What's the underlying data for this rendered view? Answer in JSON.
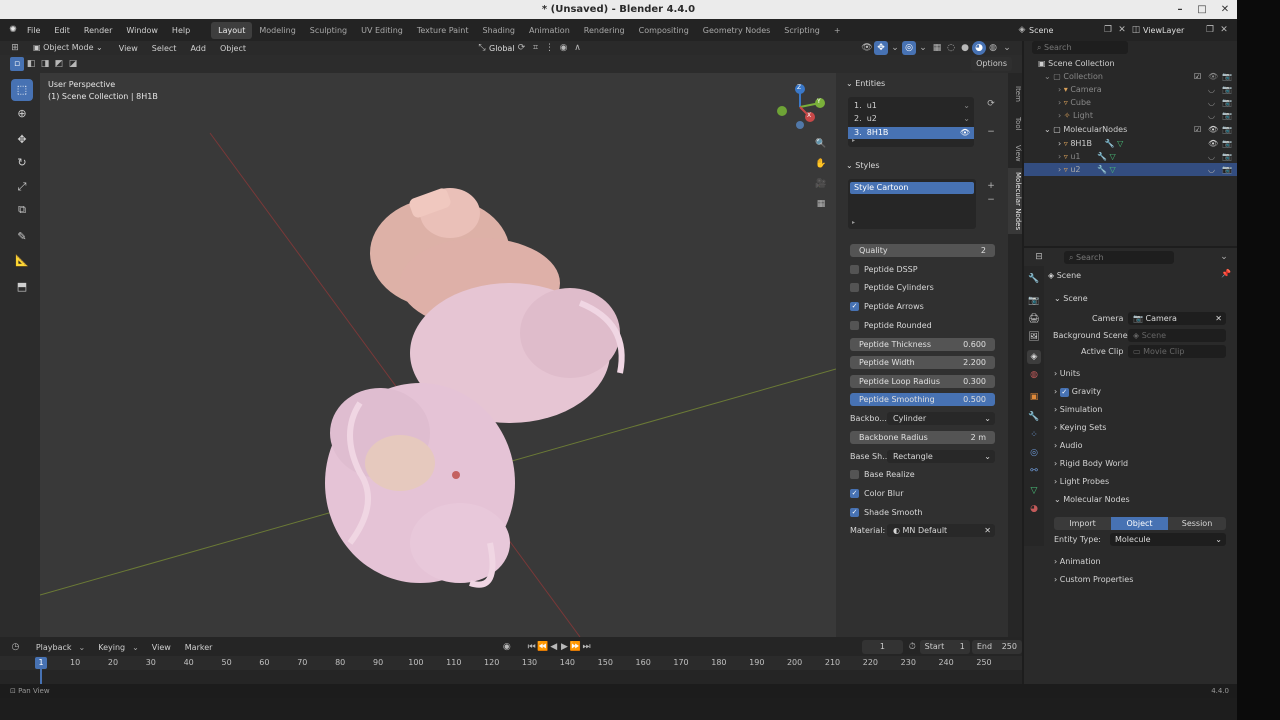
{
  "window": {
    "title": "* (Unsaved) - Blender 4.4.0",
    "minimize": "–",
    "maximize": "□",
    "close": "✕"
  },
  "menu": {
    "items": [
      "File",
      "Edit",
      "Render",
      "Window",
      "Help"
    ],
    "workspaces": [
      "Layout",
      "Modeling",
      "Sculpting",
      "UV Editing",
      "Texture Paint",
      "Shading",
      "Animation",
      "Rendering",
      "Compositing",
      "Geometry Nodes",
      "Scripting"
    ],
    "add_tab": "+",
    "scene": "Scene",
    "view_layer": "ViewLayer"
  },
  "viewport_header": {
    "mode": "Object Mode",
    "menus": [
      "View",
      "Select",
      "Add",
      "Object"
    ],
    "orientation": "Global",
    "options": "Options"
  },
  "viewport": {
    "perspective": "User Perspective",
    "collection": "(1) Scene Collection | 8H1B",
    "gizmo_x": "X",
    "gizmo_y": "Y",
    "gizmo_z": "Z"
  },
  "npanel": {
    "entities_title": "Entities",
    "entities": [
      {
        "index": "1.",
        "name": "u1"
      },
      {
        "index": "2.",
        "name": "u2"
      },
      {
        "index": "3.",
        "name": "8H1B"
      }
    ],
    "styles_title": "Styles",
    "styles": [
      "Style Cartoon"
    ],
    "quality_label": "Quality",
    "quality_value": "2",
    "peptide_dssp": "Peptide DSSP",
    "peptide_cylinders": "Peptide Cylinders",
    "peptide_arrows": "Peptide Arrows",
    "peptide_rounded": "Peptide Rounded",
    "thickness_label": "Peptide Thickness",
    "thickness_value": "0.600",
    "width_label": "Peptide Width",
    "width_value": "2.200",
    "loop_label": "Peptide Loop Radius",
    "loop_value": "0.300",
    "smoothing_label": "Peptide Smoothing",
    "smoothing_value": "0.500",
    "backbone_label": "Backbo...",
    "backbone_value": "Cylinder",
    "backbone_radius_label": "Backbone Radius",
    "backbone_radius_value": "2 m",
    "base_shape_label": "Base Sh...",
    "base_shape_value": "Rectangle",
    "base_realize": "Base Realize",
    "color_blur": "Color Blur",
    "shade_smooth": "Shade Smooth",
    "material_label": "Material:",
    "material_value": "MN Default",
    "tabs": [
      "Item",
      "Tool",
      "View",
      "Molecular Nodes"
    ]
  },
  "timeline": {
    "menus": [
      "Playback",
      "Keying",
      "View",
      "Marker"
    ],
    "current_frame": "1",
    "start_label": "Start",
    "start_value": "1",
    "end_label": "End",
    "end_value": "250",
    "ticks": [
      "1",
      "10",
      "20",
      "30",
      "40",
      "50",
      "60",
      "70",
      "80",
      "90",
      "100",
      "110",
      "120",
      "130",
      "140",
      "150",
      "160",
      "170",
      "180",
      "190",
      "200",
      "210",
      "220",
      "230",
      "240",
      "250"
    ]
  },
  "status": {
    "left": "Pan View",
    "version": "4.4.0"
  },
  "outliner": {
    "search_placeholder": "Search",
    "root": "Scene Collection",
    "collection": "Collection",
    "camera": "Camera",
    "cube": "Cube",
    "light": "Light",
    "molecular_nodes": "MolecularNodes",
    "mol_8h1b": "8H1B",
    "mol_u1": "u1",
    "mol_u2": "u2"
  },
  "properties": {
    "search_placeholder": "Search",
    "context": "Scene",
    "scene_panel": "Scene",
    "camera_label": "Camera",
    "camera_value": "Camera",
    "background_label": "Background Scene",
    "background_placeholder": "Scene",
    "clip_label": "Active Clip",
    "clip_placeholder": "Movie Clip",
    "units": "Units",
    "gravity": "Gravity",
    "simulation": "Simulation",
    "keying_sets": "Keying Sets",
    "audio": "Audio",
    "rigid_body": "Rigid Body World",
    "light_probes": "Light Probes",
    "molecular_nodes": "Molecular Nodes",
    "mn_tabs": [
      "Import",
      "Object",
      "Session"
    ],
    "entity_type_label": "Entity Type:",
    "entity_type_value": "Molecule",
    "animation": "Animation",
    "custom_properties": "Custom Properties"
  }
}
